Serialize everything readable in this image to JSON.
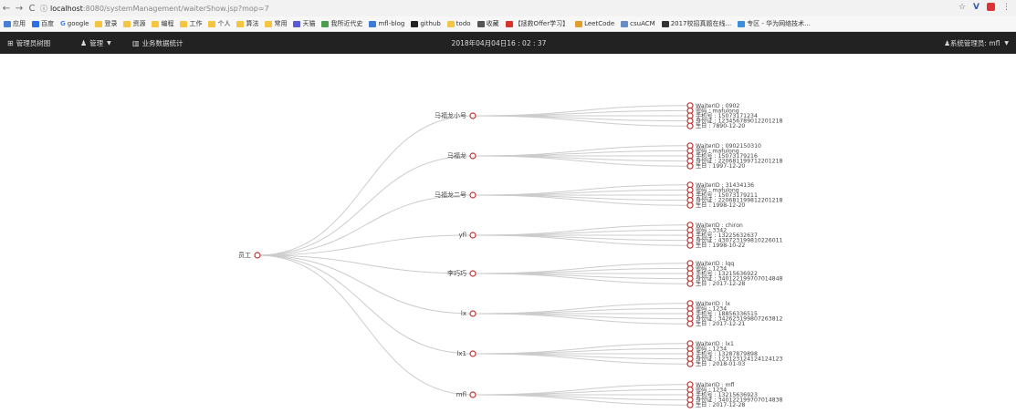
{
  "browser": {
    "url_host": "localhost",
    "url_rest": ":8080/systemManagement/waiterShow.jsp?mop=7"
  },
  "bookmarks": [
    {
      "label": "应用",
      "icon": "apps-icon"
    },
    {
      "label": "百度",
      "icon": "baidu-icon"
    },
    {
      "label": "google",
      "icon": "google-icon"
    },
    {
      "label": "登录",
      "icon": "folder-icon"
    },
    {
      "label": "资源",
      "icon": "folder-icon"
    },
    {
      "label": "编程",
      "icon": "folder-icon"
    },
    {
      "label": "工作",
      "icon": "folder-icon"
    },
    {
      "label": "个人",
      "icon": "folder-icon"
    },
    {
      "label": "算法",
      "icon": "folder-icon"
    },
    {
      "label": "常用",
      "icon": "folder-icon"
    },
    {
      "label": "天猫",
      "icon": "tmall-icon"
    },
    {
      "label": "我所近代史",
      "icon": "bookmark-icon"
    },
    {
      "label": "mfl-blog",
      "icon": "blog-icon"
    },
    {
      "label": "github",
      "icon": "github-icon"
    },
    {
      "label": "todo",
      "icon": "folder-icon"
    },
    {
      "label": "收藏",
      "icon": "book-icon"
    },
    {
      "label": "【拯救Offer学习】",
      "icon": "red-c-icon"
    },
    {
      "label": "LeetCode",
      "icon": "leetcode-icon"
    },
    {
      "label": "csuACM",
      "icon": "acm-icon"
    },
    {
      "label": "2017校招真题在线...",
      "icon": "dark-icon"
    },
    {
      "label": "专区 - 华为网络技术...",
      "icon": "cloud-icon"
    }
  ],
  "navbar": {
    "home": "管理员树图",
    "manage": "管理",
    "stats": "业务数据统计",
    "datetime": "2018年04月04日16 : 02 : 37",
    "user": "系统管理员: mfl"
  },
  "tree": {
    "root": "员工",
    "children": [
      {
        "name": "马福龙小号",
        "details": [
          "WaiterID : 0902",
          "密码 : mafulong",
          "手机号 : 15073171234",
          "身份证 : 123456789012201218",
          "生日 : 7890-12-20"
        ]
      },
      {
        "name": "马福龙",
        "details": [
          "WaiterID : 0902150310",
          "密码 : mafulong",
          "手机号 : 15073179216",
          "身份证 : 220681199712201218",
          "生日 : 1997-12-20"
        ]
      },
      {
        "name": "马福龙二号",
        "details": [
          "WaiterID : 31434136",
          "密码 : mafulong",
          "手机号 : 15073179211",
          "身份证 : 220681199812201218",
          "生日 : 1998-12-20"
        ]
      },
      {
        "name": "yfl",
        "details": [
          "WaiterID : chiron",
          "密码 : 3342",
          "手机号 : 13225632637",
          "身份证 : 430723199810226011",
          "生日 : 1998-10-22"
        ]
      },
      {
        "name": "李巧巧",
        "details": [
          "WaiterID : lqq",
          "密码 : 1234",
          "手机号 : 13215636922",
          "身份证 : 340122199707014848",
          "生日 : 2017-12-28"
        ]
      },
      {
        "name": "lx",
        "details": [
          "WaiterID : lx",
          "密码 : 1234",
          "手机号 : 18856336515",
          "身份证 : 342623199807263812",
          "生日 : 2017-12-21"
        ]
      },
      {
        "name": "lx1",
        "details": [
          "WaiterID : lx1",
          "密码 : 1234",
          "手机号 : 13287879898",
          "身份证 : 123123124124124123",
          "生日 : 2018-01-03"
        ]
      },
      {
        "name": "mfl",
        "details": [
          "WaiterID : mfl",
          "密码 : 1234",
          "手机号 : 13215636923",
          "身份证 : 340122199707014838",
          "生日 : 2017-12-28"
        ]
      }
    ]
  },
  "colors": {
    "node_stroke": "#c23531",
    "link": "#cccccc",
    "navbar_bg": "#222222"
  }
}
